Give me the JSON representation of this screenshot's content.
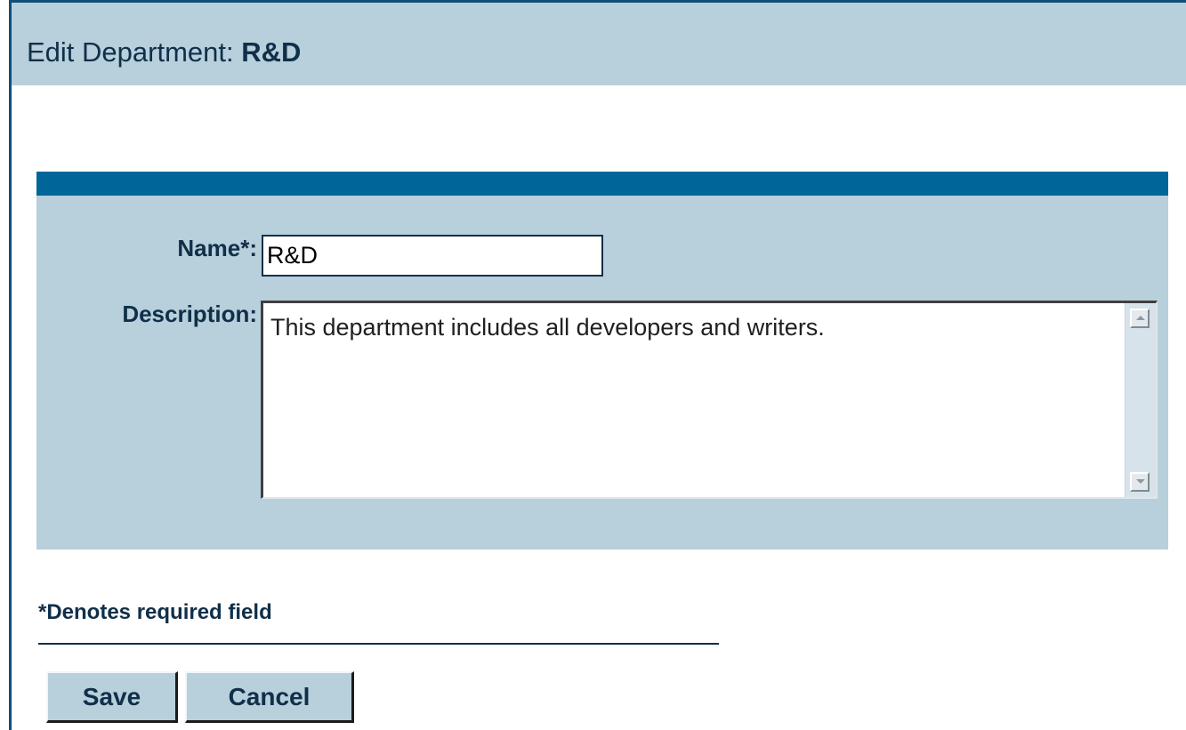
{
  "header": {
    "title_prefix": "Edit Department: ",
    "department_name": "R&D"
  },
  "form": {
    "name_label": "Name*:",
    "name_value": "R&D",
    "description_label": "Description:",
    "description_value": "This department includes all developers and writers."
  },
  "footer": {
    "required_note": "*Denotes required field",
    "save_label": "Save",
    "cancel_label": "Cancel"
  },
  "colors": {
    "panel_bg": "#b8cfdc",
    "header_stripe": "#006699",
    "text_dark": "#102f49",
    "frame_border": "#0f4f7a"
  },
  "icons": {
    "scroll_up": "scroll-up-arrow-icon",
    "scroll_down": "scroll-down-arrow-icon"
  }
}
